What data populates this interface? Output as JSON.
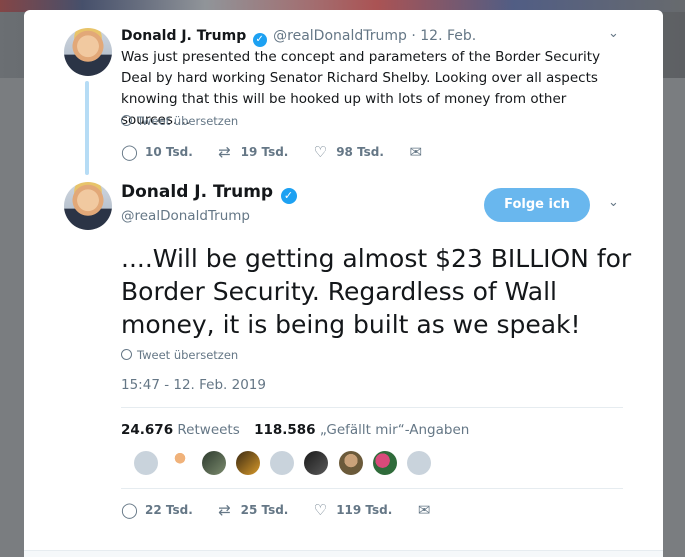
{
  "tweet1": {
    "name": "Donald J. Trump",
    "handle": "@realDonaldTrump",
    "date": "· 12. Feb.",
    "text": "Was just presented the concept and parameters of the Border Security Deal by hard working Senator Richard Shelby. Looking over all aspects knowing that this will be hooked up with lots of money from other sources....",
    "translate_label": "Tweet übersetzen",
    "replies": "10 Tsd.",
    "retweets": "19 Tsd.",
    "likes": "98 Tsd."
  },
  "tweet2": {
    "name": "Donald J. Trump",
    "handle": "@realDonaldTrump",
    "follow_label": "Folge ich",
    "text": "....Will be getting almost $23 BILLION for Border Security. Regardless of Wall money, it is being built as we speak!",
    "translate_label": "Tweet übersetzen",
    "timestamp": "15:47 - 12. Feb. 2019",
    "retweet_count": "24.676",
    "retweet_label": "Retweets",
    "like_count": "118.586",
    "like_label": "„Gefällt mir“-Angaben",
    "replies": "22 Tsd.",
    "retweets": "25 Tsd.",
    "likes": "119 Tsd."
  },
  "icons": {
    "verified": "✓",
    "chevron": "⌄",
    "reply": "◯",
    "retweet": "⇄",
    "like": "♡",
    "dm": "✉"
  },
  "colors": {
    "accent": "#1da1f2",
    "follow_button": "#69b7ee",
    "muted": "#657786",
    "thread_line": "#b6dcf5"
  }
}
